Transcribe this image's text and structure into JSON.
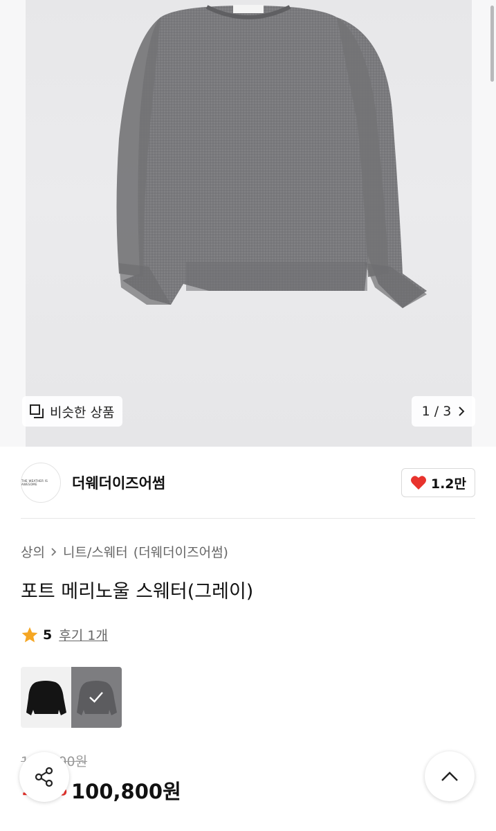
{
  "gallery": {
    "similar_label": "비슷한 상품",
    "counter": "1 / 3",
    "icons": [
      "similar-products-icon",
      "chevron-right-icon"
    ]
  },
  "seller": {
    "name": "더웨더이즈어썸",
    "avatar_text": "THE WEATHER IS AWESOME",
    "likes": "1.2만"
  },
  "breadcrumb": {
    "category": "상의",
    "subcategory": "니트/스웨터",
    "brand": "(더웨더이즈어썸)"
  },
  "product": {
    "title": "포트 메리노울 스웨터(그레이)",
    "rating": "5",
    "reviews": "후기 1개",
    "original_price": "120,000원",
    "discount": "16%",
    "price": "100,800원"
  },
  "swatches": [
    {
      "name": "black",
      "selected": false
    },
    {
      "name": "gray",
      "selected": true
    }
  ],
  "colors": {
    "accent_red": "#e8332d",
    "heart": "#e8332d",
    "star": "#f5a623"
  }
}
